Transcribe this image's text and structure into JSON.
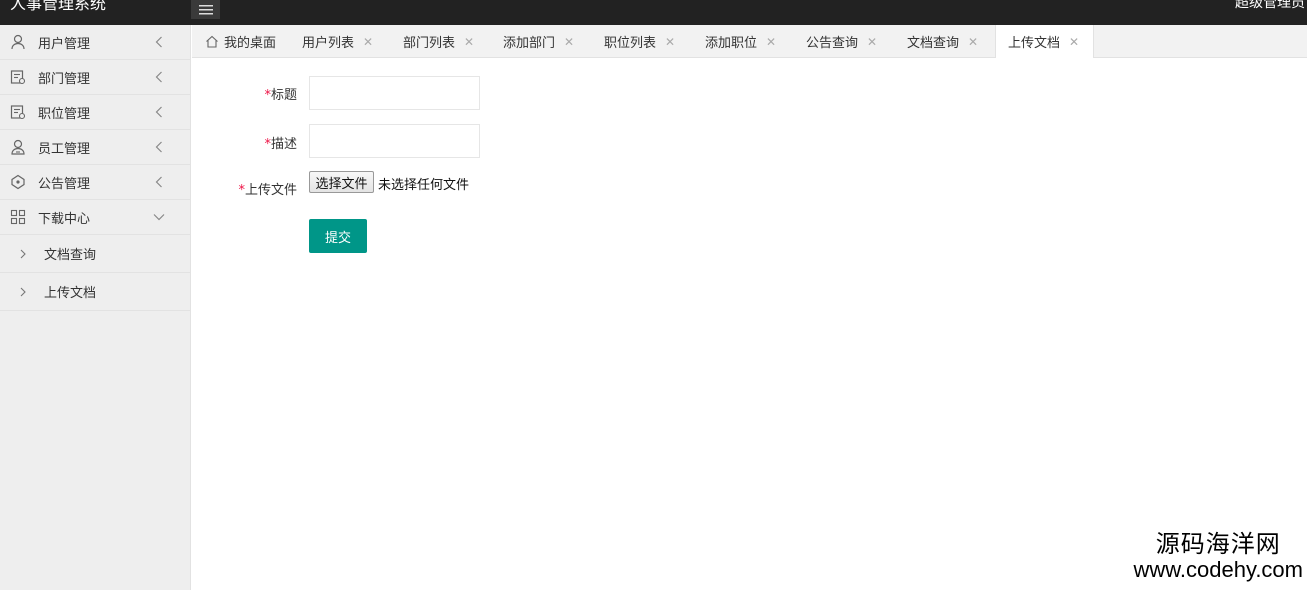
{
  "header": {
    "app_title": "人事管理系统",
    "user_name": "超级管理员"
  },
  "sidebar": {
    "items": [
      {
        "label": "用户管理",
        "icon": "user-icon"
      },
      {
        "label": "部门管理",
        "icon": "department-icon"
      },
      {
        "label": "职位管理",
        "icon": "position-icon"
      },
      {
        "label": "员工管理",
        "icon": "employee-icon"
      },
      {
        "label": "公告管理",
        "icon": "notice-icon"
      },
      {
        "label": "下载中心",
        "icon": "grid-icon",
        "expanded": true
      }
    ],
    "subitems": [
      {
        "label": "文档查询"
      },
      {
        "label": "上传文档"
      }
    ]
  },
  "tabs": [
    {
      "label": "我的桌面",
      "icon": "home-icon"
    },
    {
      "label": "用户列表",
      "close": "✕"
    },
    {
      "label": "部门列表",
      "close": "✕"
    },
    {
      "label": "添加部门",
      "close": "✕"
    },
    {
      "label": "职位列表",
      "close": "✕"
    },
    {
      "label": "添加职位",
      "close": "✕"
    },
    {
      "label": "公告查询",
      "close": "✕"
    },
    {
      "label": "文档查询",
      "close": "✕"
    },
    {
      "label": "上传文档",
      "close": "✕",
      "active": true
    }
  ],
  "form": {
    "required_mark": "*",
    "title_label": "标题",
    "title_value": "",
    "desc_label": "描述",
    "desc_value": "",
    "file_label": "上传文件",
    "file_button": "选择文件",
    "file_status": "未选择任何文件",
    "submit_label": "提交"
  },
  "watermark": {
    "line1": "源码海洋网",
    "line2": "www.codehy.com"
  },
  "colors": {
    "topbar": "#222222",
    "sidebar": "#eeeeee",
    "primary_button": "#009688",
    "required": "#ee1144"
  }
}
